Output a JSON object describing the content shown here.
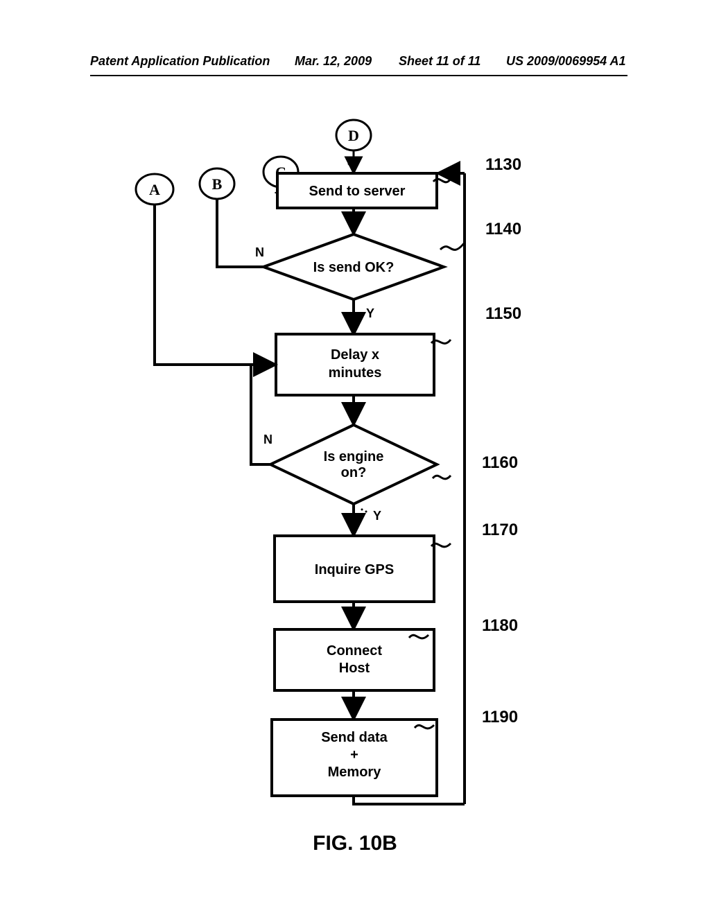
{
  "header": {
    "publication_label": "Patent Application Publication",
    "date": "Mar. 12, 2009",
    "sheet": "Sheet 11 of 11",
    "pub_number": "US 2009/0069954 A1"
  },
  "figure": {
    "caption": "FIG. 10B"
  },
  "connectors": {
    "A": "A",
    "B": "B",
    "C": "C",
    "D": "D"
  },
  "nodes": {
    "send_server": {
      "label": "Send to server",
      "ref": "1130"
    },
    "is_send_ok": {
      "label": "Is send OK?",
      "ref": "1140",
      "yes": "Y",
      "no": "N"
    },
    "delay": {
      "line1": "Delay x",
      "line2": "minutes",
      "ref": "1150"
    },
    "is_engine_on": {
      "line1": "Is engine",
      "line2": "on?",
      "ref": "1160",
      "yes": "Y",
      "no": "N"
    },
    "inquire_gps": {
      "label": "Inquire GPS",
      "ref": "1170"
    },
    "connect_host": {
      "line1": "Connect",
      "line2": "Host",
      "ref": "1180"
    },
    "send_data": {
      "line1": "Send data",
      "line2": "+",
      "line3": "Memory",
      "ref": "1190"
    }
  }
}
